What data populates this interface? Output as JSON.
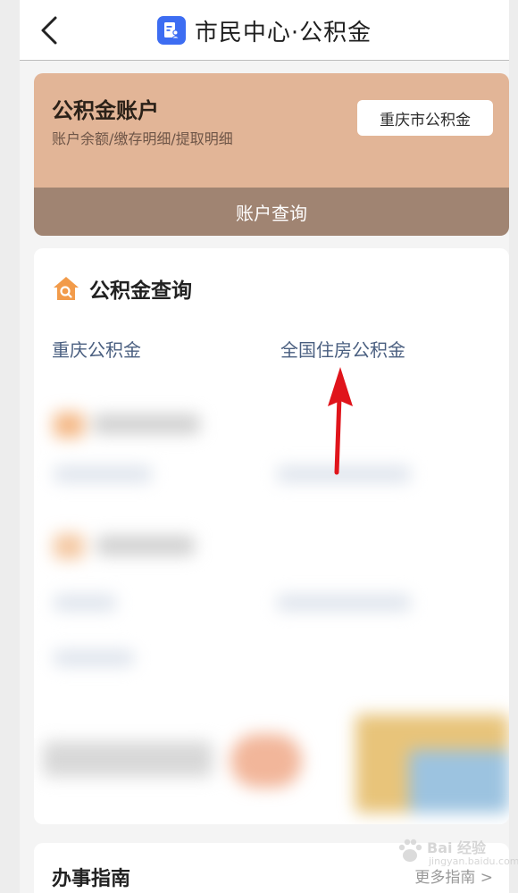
{
  "header": {
    "title": "市民中心·公积金",
    "back_icon": "chevron-left-icon",
    "title_icon": "document-person-icon"
  },
  "account_card": {
    "title": "公积金账户",
    "subtitle": "账户余额/缴存明细/提取明细",
    "city_button": "重庆市公积金",
    "query_button": "账户查询"
  },
  "query_section": {
    "title": "公积金查询",
    "icon": "house-search-icon",
    "links": [
      "重庆公积金",
      "全国住房公积金"
    ]
  },
  "guide_section": {
    "title": "办事指南",
    "more": "更多指南 >"
  },
  "watermark": {
    "text": "Bai 经验",
    "sub": "jingyan.baidu.com"
  },
  "colors": {
    "accent_blue": "#3d6df2",
    "card_tan": "#e2b597",
    "card_brown": "#a08472",
    "link": "#4a5f80",
    "house_icon": "#f29b4a",
    "arrow_red": "#e0141b"
  }
}
